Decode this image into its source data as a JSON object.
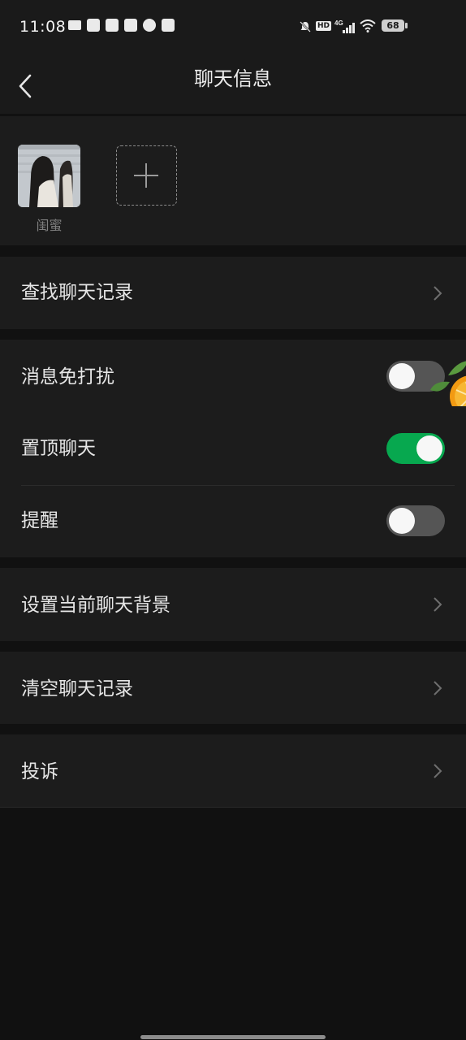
{
  "status_bar": {
    "time": "11:08",
    "network": "4G",
    "hd": "HD",
    "battery": "68"
  },
  "header": {
    "title": "聊天信息"
  },
  "members": [
    {
      "name": "闺蜜"
    }
  ],
  "rows": {
    "search_history": "查找聊天记录",
    "mute": {
      "label": "消息免打扰",
      "enabled": false
    },
    "pin": {
      "label": "置顶聊天",
      "enabled": true
    },
    "remind": {
      "label": "提醒",
      "enabled": false
    },
    "background": "设置当前聊天背景",
    "clear_history": "清空聊天记录",
    "report": "投诉"
  },
  "colors": {
    "background": "#111111",
    "panel": "#1c1c1c",
    "toggle_on": "#07a84f",
    "toggle_off": "#555555"
  },
  "icons": [
    "back-chevron-icon",
    "add-member-plus-icon",
    "chevron-right-icon"
  ]
}
